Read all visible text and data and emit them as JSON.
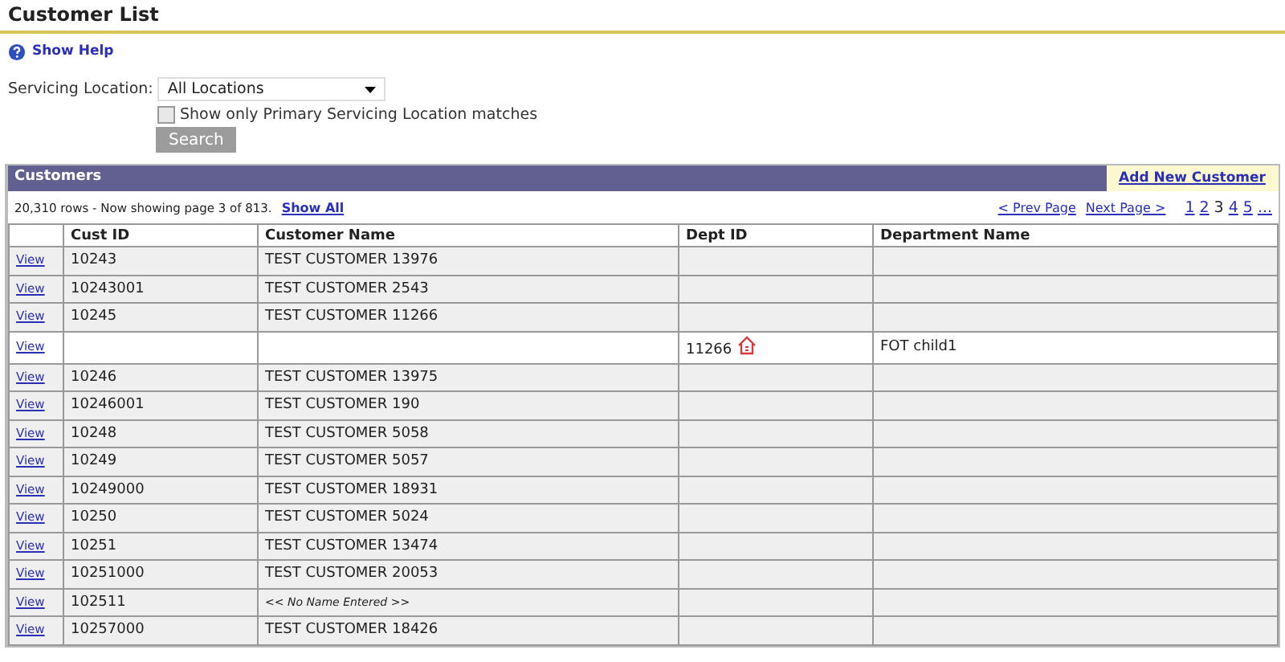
{
  "page_title": "Customer List",
  "help_link": "Show Help",
  "filter": {
    "label": "Servicing Location:",
    "value": "All Locations",
    "checkbox_label": "Show only Primary Servicing Location matches",
    "checked": false,
    "button": "Search"
  },
  "panel": {
    "title": "Customers",
    "add_link": "Add New Customer"
  },
  "summary": {
    "text": "20,310 rows - Now showing page 3 of 813.",
    "show_all": "Show All"
  },
  "pager": {
    "prev": "< Prev Page",
    "next": "Next Page >",
    "pages": [
      {
        "label": "1",
        "selected": false
      },
      {
        "label": "2",
        "selected": false
      },
      {
        "label": "3",
        "selected": true
      },
      {
        "label": "4",
        "selected": false
      },
      {
        "label": "5",
        "selected": false
      },
      {
        "label": "...",
        "selected": false
      }
    ]
  },
  "table": {
    "columns": [
      "",
      "Cust ID",
      "Customer Name",
      "Dept ID",
      "Department Name"
    ],
    "rows": [
      {
        "kind": "customer",
        "link": "View",
        "cust_id": "10243",
        "name": "TEST CUSTOMER 13976"
      },
      {
        "kind": "customer",
        "link": "View",
        "cust_id": "10243001",
        "name": "TEST CUSTOMER 2543"
      },
      {
        "kind": "customer",
        "link": "View",
        "cust_id": "10245",
        "name": "TEST CUSTOMER 11266"
      },
      {
        "kind": "department",
        "link": "View",
        "dept_id": "11266",
        "dept_name": "FOT child1"
      },
      {
        "kind": "customer",
        "link": "View",
        "cust_id": "10246",
        "name": "TEST CUSTOMER 13975"
      },
      {
        "kind": "customer",
        "link": "View",
        "cust_id": "10246001",
        "name": "TEST CUSTOMER 190"
      },
      {
        "kind": "customer",
        "link": "View",
        "cust_id": "10248",
        "name": "TEST CUSTOMER 5058"
      },
      {
        "kind": "customer",
        "link": "View",
        "cust_id": "10249",
        "name": "TEST CUSTOMER 5057"
      },
      {
        "kind": "customer",
        "link": "View",
        "cust_id": "10249000",
        "name": "TEST CUSTOMER 18931"
      },
      {
        "kind": "customer",
        "link": "View",
        "cust_id": "10250",
        "name": "TEST CUSTOMER 5024"
      },
      {
        "kind": "customer",
        "link": "View",
        "cust_id": "10251",
        "name": "TEST CUSTOMER 13474"
      },
      {
        "kind": "customer",
        "link": "View",
        "cust_id": "10251000",
        "name": "TEST CUSTOMER 20053"
      },
      {
        "kind": "unnamed",
        "link": "View",
        "cust_id": "102511",
        "name": "<< No Name Entered >>"
      },
      {
        "kind": "customer",
        "link": "View",
        "cust_id": "10257000",
        "name": "TEST CUSTOMER 18426"
      }
    ]
  }
}
